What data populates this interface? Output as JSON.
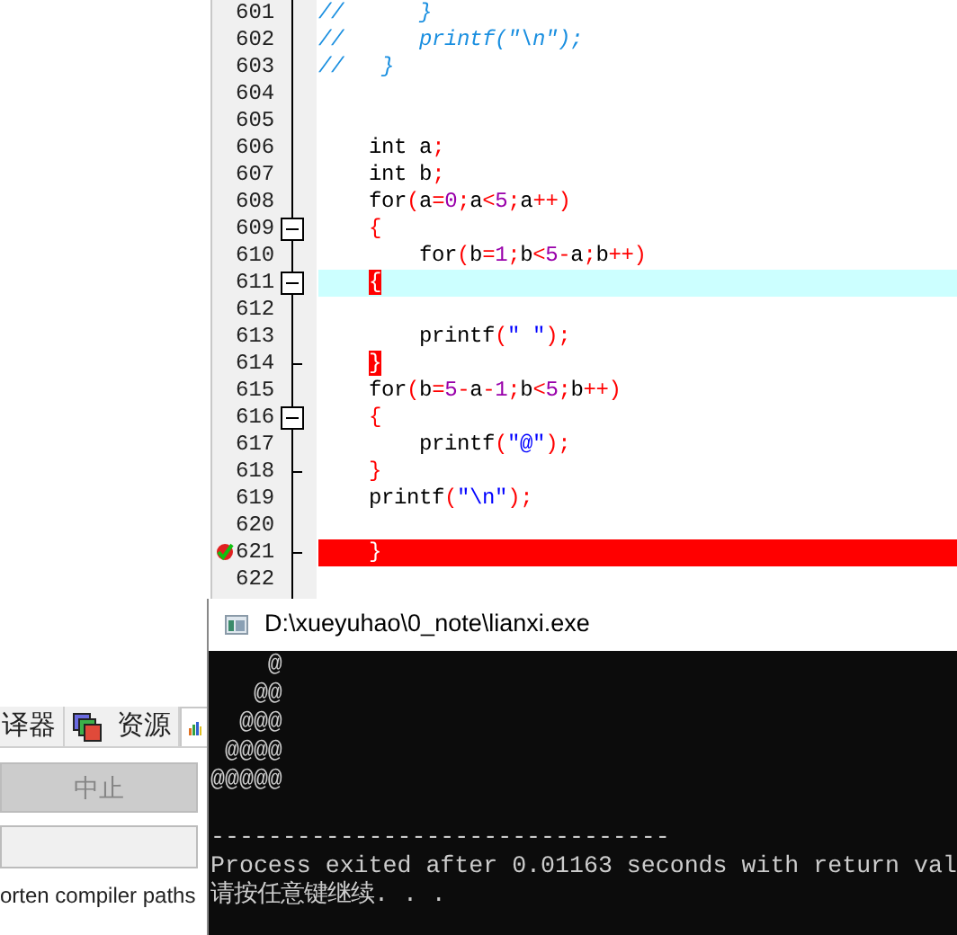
{
  "side_panel": {
    "tabs": [
      {
        "kind": "text",
        "label": "译器",
        "selected": false
      },
      {
        "kind": "icon_text",
        "label": "资源",
        "selected": false
      },
      {
        "kind": "icon",
        "selected": true
      }
    ],
    "abort_button": {
      "label": "中止",
      "disabled": true
    },
    "option_text": "orten compiler paths"
  },
  "editor": {
    "lines": [
      {
        "number": "601",
        "kind": "comment",
        "text": "//      }",
        "current": false,
        "error": false,
        "matched": false,
        "breakpoint": false
      },
      {
        "number": "602",
        "kind": "comment",
        "text": "//      printf(\"\\n\");",
        "current": false,
        "error": false,
        "matched": false,
        "breakpoint": false
      },
      {
        "number": "603",
        "kind": "comment",
        "text": "//   }",
        "current": false,
        "error": false,
        "matched": false,
        "breakpoint": false
      },
      {
        "number": "604",
        "kind": "blank",
        "current": false,
        "error": false,
        "breakpoint": false
      },
      {
        "number": "605",
        "kind": "blank",
        "current": false,
        "error": false,
        "breakpoint": false
      },
      {
        "number": "606",
        "kind": "code",
        "text": "    int a;",
        "current": false,
        "error": false,
        "matched": false,
        "breakpoint": false
      },
      {
        "number": "607",
        "kind": "code",
        "text": "    int b;",
        "current": false,
        "error": false,
        "matched": false,
        "breakpoint": false
      },
      {
        "number": "608",
        "kind": "code",
        "text": "    for(a=0;a<5;a++)",
        "current": false,
        "error": false,
        "matched": false,
        "breakpoint": false
      },
      {
        "number": "609",
        "kind": "fold_open",
        "text": "    {",
        "current": false,
        "error": false,
        "matched": false,
        "breakpoint": false
      },
      {
        "number": "610",
        "kind": "code",
        "text": "        for(b=1;b<5-a;b++)",
        "current": false,
        "error": false,
        "matched": false,
        "breakpoint": false
      },
      {
        "number": "611",
        "kind": "fold_open",
        "text": "    {",
        "current": true,
        "error": false,
        "matched": true,
        "breakpoint": false
      },
      {
        "number": "612",
        "kind": "blank",
        "current": false,
        "error": false,
        "breakpoint": false
      },
      {
        "number": "613",
        "kind": "code",
        "text": "        printf(\" \");",
        "current": false,
        "error": false,
        "matched": false,
        "breakpoint": false
      },
      {
        "number": "614",
        "kind": "fold_end",
        "text": "    }",
        "current": false,
        "error": false,
        "matched": true,
        "breakpoint": false
      },
      {
        "number": "615",
        "kind": "code",
        "text": "    for(b=5-a-1;b<5;b++)",
        "current": false,
        "error": false,
        "matched": false,
        "breakpoint": false
      },
      {
        "number": "616",
        "kind": "fold_open",
        "text": "    {",
        "current": false,
        "error": false,
        "matched": false,
        "breakpoint": false
      },
      {
        "number": "617",
        "kind": "code",
        "text": "        printf(\"@\");",
        "current": false,
        "error": false,
        "matched": false,
        "breakpoint": false
      },
      {
        "number": "618",
        "kind": "fold_end",
        "text": "    }",
        "current": false,
        "error": false,
        "matched": false,
        "breakpoint": false
      },
      {
        "number": "619",
        "kind": "code",
        "text": "    printf(\"\\n\");",
        "current": false,
        "error": false,
        "matched": false,
        "breakpoint": false
      },
      {
        "number": "620",
        "kind": "blank",
        "current": false,
        "error": false,
        "breakpoint": false
      },
      {
        "number": "621",
        "kind": "fold_end",
        "text": "    }",
        "current": false,
        "error": true,
        "matched": false,
        "breakpoint": true
      },
      {
        "number": "622",
        "kind": "blank",
        "current": false,
        "error": false,
        "breakpoint": false
      }
    ]
  },
  "console": {
    "title": "D:\\xueyuhao\\0_note\\lianxi.exe",
    "output": [
      "    @",
      "   @@",
      "  @@@",
      " @@@@",
      "@@@@@"
    ],
    "footer": [
      "--------------------------------",
      "Process exited after 0.01163 seconds with return val",
      "请按任意键继续. . ."
    ]
  }
}
